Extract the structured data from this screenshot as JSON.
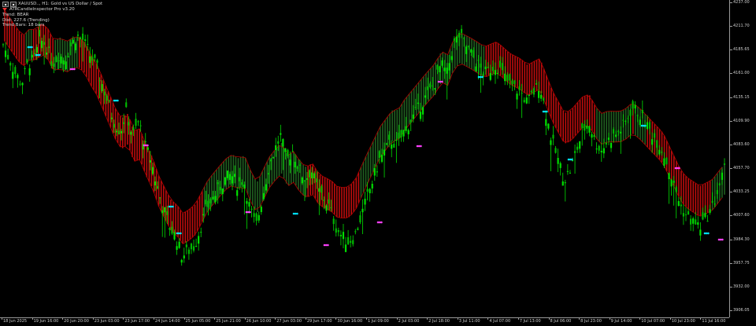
{
  "info": {
    "symbol_line": "XAUUSD.., H1: Gold vs US Dollar / Spot",
    "indicator_name": "ATRCandleInspector Pro v3.20",
    "trend_line": "Trend: BEAR",
    "dist_line": "Dist: 227.6 (Trending)",
    "bars_line": "Trend Bars: 18 bars"
  },
  "price_axis": {
    "labels": [
      "4237.00",
      "4211.70",
      "4185.65",
      "4161.00",
      "4135.15",
      "4109.90",
      "4083.60",
      "4057.70",
      "4033.25",
      "4007.60",
      "3984.30",
      "3957.75",
      "3932.00",
      "3906.05"
    ],
    "current_price": "4057.70"
  },
  "time_axis": {
    "labels": [
      "18 Jun 2025",
      "19 Jun 16:00",
      "20 Jun 20:00",
      "23 Jun 03:00",
      "23 Jun 17:00",
      "24 Jun 14:00",
      "25 Jun 05:00",
      "25 Jun 21:00",
      "26 Jun 10:00",
      "27 Jun 03:00",
      "29 Jun 17:00",
      "30 Jun 16:00",
      "1 Jul 09:00",
      "2 Jul 03:00",
      "2 Jul 18:00",
      "3 Jul 11:00",
      "4 Jul 07:00",
      "7 Jul 13:00",
      "8 Jul 06:00",
      "8 Jul 23:00",
      "9 Jul 14:00",
      "10 Jul 07:00",
      "10 Jul 23:00",
      "11 Jul 16:00"
    ]
  },
  "colors": {
    "background": "#000000",
    "bull_candle": "#00e000",
    "bear_band": "#e01010",
    "bull_band": "#2a7a2a",
    "buy_marker": "#00e5ff",
    "sell_marker": "#ff40ff"
  },
  "chart_data": {
    "type": "candlestick",
    "ylim": [
      3906,
      4237
    ],
    "close_path": [
      4190,
      4175,
      4160,
      4150,
      4170,
      4175,
      4195,
      4190,
      4170,
      4180,
      4175,
      4190,
      4200,
      4195,
      4180,
      4170,
      4150,
      4130,
      4110,
      4100,
      4120,
      4095,
      4110,
      4085,
      4070,
      4040,
      4020,
      4000,
      3990,
      3970,
      3975,
      3980,
      4000,
      4020,
      4030,
      4040,
      4050,
      4055,
      4045,
      4050,
      4020,
      4000,
      4030,
      4060,
      4080,
      4095,
      4070,
      4080,
      4060,
      4050,
      4060,
      4040,
      4030,
      4020,
      4000,
      3990,
      3985,
      3990,
      4010,
      4030,
      4050,
      4070,
      4080,
      4090,
      4085,
      4100,
      4110,
      4120,
      4130,
      4140,
      4150,
      4170,
      4160,
      4190,
      4200,
      4190,
      4180,
      4170,
      4160,
      4165,
      4170,
      4160,
      4150,
      4145,
      4140,
      4130,
      4140,
      4150,
      4120,
      4090,
      4070,
      4050,
      4060,
      4080,
      4100,
      4110,
      4090,
      4080,
      4090,
      4095,
      4100,
      4110,
      4125,
      4120,
      4110,
      4100,
      4090,
      4080,
      4060,
      4040,
      4020,
      4010,
      4005,
      4000,
      4010,
      4020,
      4040,
      4060
    ],
    "band_center": [
      4210,
      4205,
      4198,
      4190,
      4180,
      4172,
      4165,
      4160,
      4150,
      4140,
      4125,
      4110,
      4095,
      4080,
      4065,
      4050,
      4035,
      4022,
      4012,
      4005,
      4005,
      4010,
      4018,
      4025,
      4033,
      4040,
      4045,
      4048,
      4045,
      4040,
      4035,
      4030,
      4028,
      4026,
      4024,
      4022,
      4020,
      4025,
      4035,
      4045,
      4058,
      4070,
      4080,
      4090,
      4100,
      4110,
      4118,
      4126,
      4134,
      4140,
      4146,
      4150,
      4155,
      4160,
      4163,
      4165,
      4165,
      4163,
      4160,
      4158,
      4155,
      4150,
      4145,
      4140,
      4135,
      4128,
      4120,
      4112,
      4105,
      4098,
      4090,
      4085,
      4080,
      4075,
      4070,
      4065,
      4055,
      4045,
      4040,
      4035,
      4030,
      4025,
      4020
    ]
  }
}
